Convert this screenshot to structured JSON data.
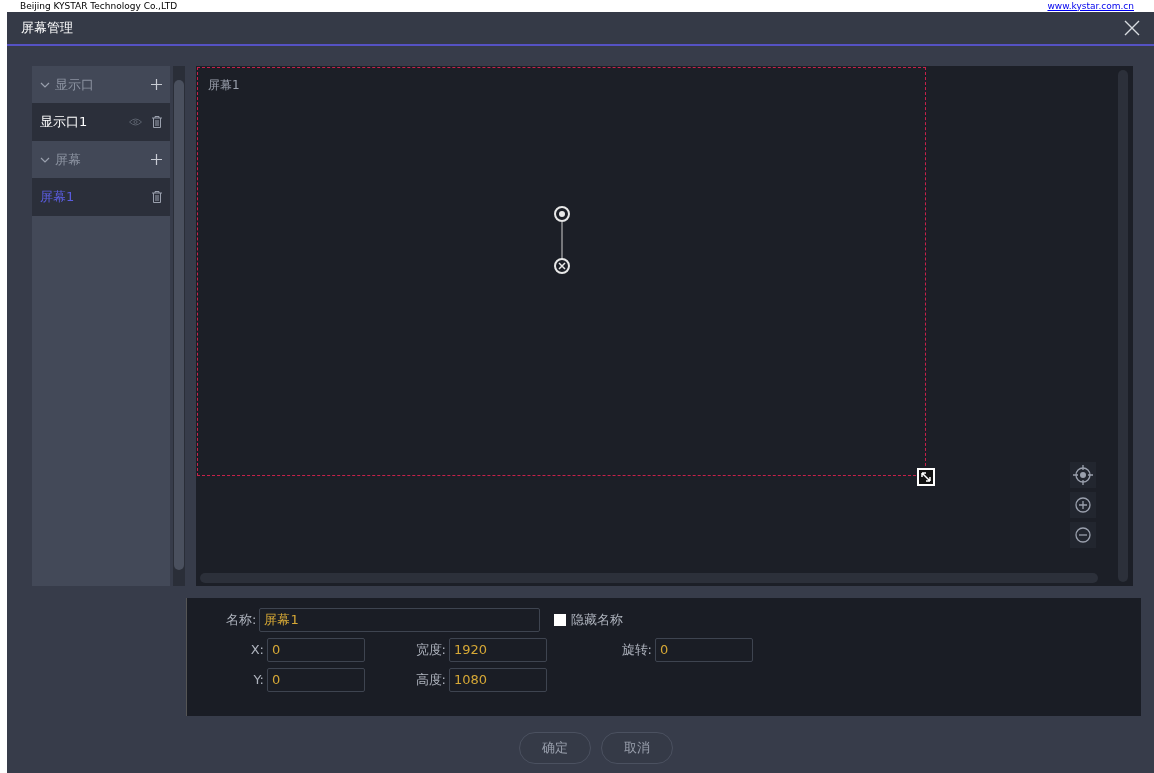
{
  "page_header": {
    "company": "Beijing KYSTAR Technology Co.,LTD",
    "link": "www.kystar.com.cn"
  },
  "window": {
    "title": "屏幕管理"
  },
  "sidebar": {
    "groups": [
      {
        "label": "显示口",
        "expanded": true,
        "children": [
          {
            "label": "显示口1",
            "selected": false,
            "kind": "output"
          }
        ]
      },
      {
        "label": "屏幕",
        "expanded": true,
        "children": [
          {
            "label": "屏幕1",
            "selected": true,
            "kind": "screen"
          }
        ]
      }
    ]
  },
  "canvas": {
    "screen_label": "屏幕1"
  },
  "properties": {
    "name": {
      "label": "名称:",
      "value": "屏幕1"
    },
    "hide_name": {
      "label": "隐藏名称",
      "checked": false
    },
    "fields": [
      {
        "label": "X:",
        "value": "0"
      },
      {
        "label": "宽度:",
        "value": "1920"
      },
      {
        "label": "旋转:",
        "value": "0"
      },
      {
        "label": "Y:",
        "value": "0"
      },
      {
        "label": "高度:",
        "value": "1080"
      }
    ]
  },
  "buttons": [
    "确定",
    "取消"
  ]
}
